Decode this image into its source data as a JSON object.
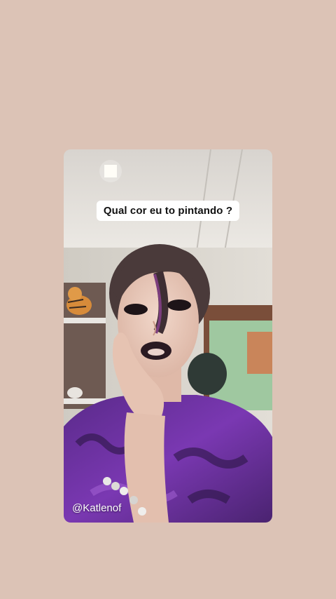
{
  "story": {
    "caption": "Qual cor eu to pintando ?",
    "watermark": "@Katlenof"
  },
  "colors": {
    "background": "#dcc3b6",
    "shirt": "#6a2fa0",
    "wall_green": "#9fc8a0"
  }
}
